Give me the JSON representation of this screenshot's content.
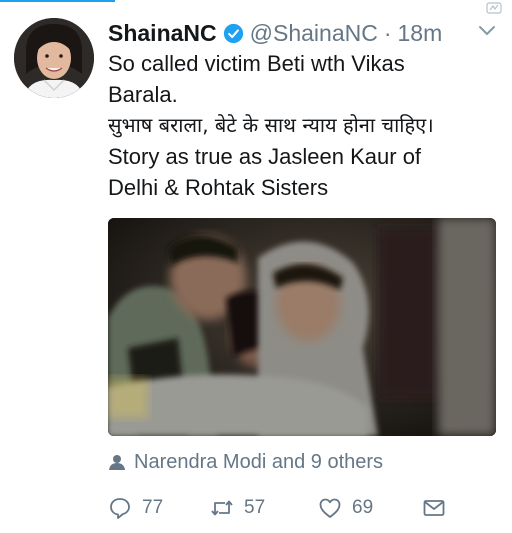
{
  "tweet": {
    "display_name": "ShainaNC",
    "handle": "@ShainaNC",
    "separator": "·",
    "time": "18m",
    "lines": [
      "So called victim Beti wth Vikas",
      "Barala.",
      "सुभाष बराला, बेटे के साथ न्याय होना चाहिए।",
      "Story as true as Jasleen Kaur of",
      "Delhi & Rohtak Sisters"
    ],
    "liked_by": "Narendra Modi and 9 others",
    "counts": {
      "replies": "77",
      "retweets": "57",
      "likes": "69"
    }
  },
  "colors": {
    "accent": "#1da1f2",
    "secondary_text": "#657786",
    "primary_text": "#14171a"
  },
  "icons": {
    "verified": "verified-badge-icon",
    "menu": "chevron-down-icon",
    "liked_by": "person-icon",
    "reply": "reply-icon",
    "retweet": "retweet-icon",
    "like": "heart-icon",
    "dm": "envelope-icon"
  }
}
